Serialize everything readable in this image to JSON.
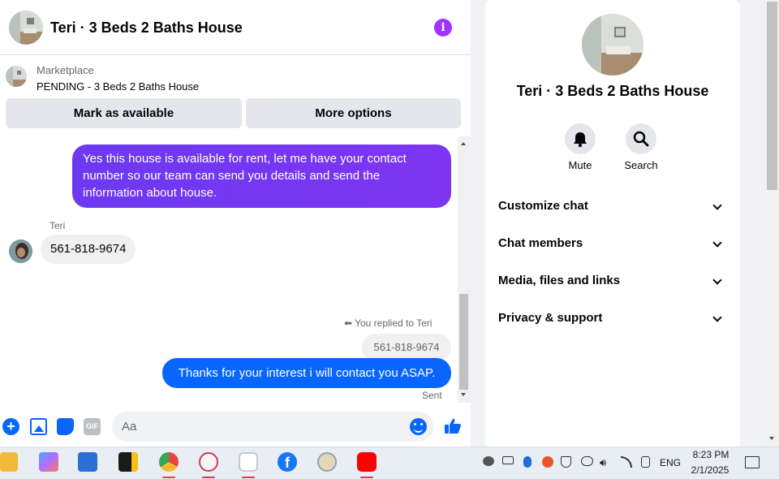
{
  "chat": {
    "title": "Teri · 3 Beds 2 Baths House",
    "marketplace_label": "Marketplace",
    "listing_status": "PENDING - 3 Beds 2 Baths House",
    "mark_available_label": "Mark as available",
    "more_options_label": "More options"
  },
  "messages": {
    "outgoing_1": "Yes this house is  available for rent, let me have your contact number so our team can send you details and send the information about house.",
    "sender_name": "Teri",
    "incoming_1": "561-818-9674",
    "replied_note": "You replied to Teri",
    "quoted_text": "561-818-9674",
    "outgoing_2": "Thanks for your interest i will contact you ASAP.",
    "sent_status": "Sent"
  },
  "composer": {
    "placeholder": "Aa",
    "gif_label": "GIF"
  },
  "info_panel": {
    "title": "Teri · 3 Beds 2 Baths House",
    "mute_label": "Mute",
    "search_label": "Search",
    "sections": [
      "Customize chat",
      "Chat members",
      "Media, files and links",
      "Privacy & support"
    ]
  },
  "taskbar": {
    "language": "ENG",
    "time": "8:23 PM",
    "date": "2/1/2025"
  },
  "colors": {
    "accent_blue": "#0866ff",
    "accent_purple": "#a033ff",
    "outgoing_purple": "#7539f2"
  }
}
